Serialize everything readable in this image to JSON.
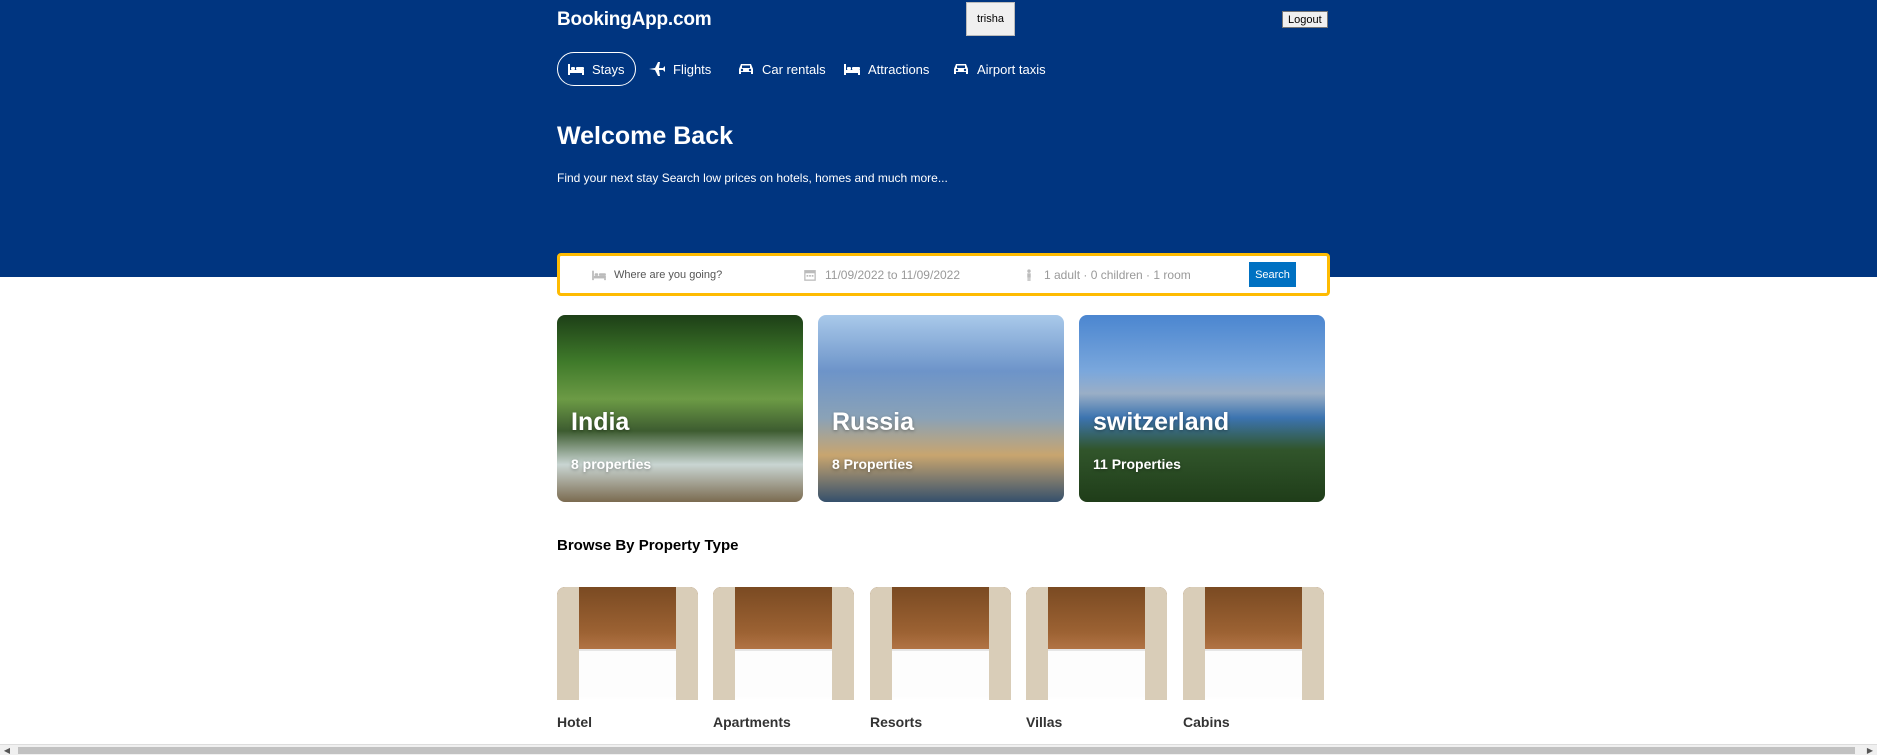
{
  "navbar": {
    "logo": "BookingApp.com",
    "user_label": "trisha",
    "logout_label": "Logout"
  },
  "tabs": [
    {
      "label": "Stays",
      "icon": "bed-icon",
      "active": true
    },
    {
      "label": "Flights",
      "icon": "plane-icon",
      "active": false
    },
    {
      "label": "Car rentals",
      "icon": "car-icon",
      "active": false
    },
    {
      "label": "Attractions",
      "icon": "bed-icon",
      "active": false
    },
    {
      "label": "Airport taxis",
      "icon": "taxi-icon",
      "active": false
    }
  ],
  "hero": {
    "title": "Welcome Back",
    "subtitle": "Find your next stay Search low prices on hotels, homes and much more..."
  },
  "search": {
    "destination_placeholder": "Where are you going?",
    "dates": "11/09/2022 to 11/09/2022",
    "guests": "1 adult · 0 children · 1 room",
    "button_label": "Search"
  },
  "featured": [
    {
      "city": "India",
      "properties": "8 properties"
    },
    {
      "city": "Russia",
      "properties": "8 Properties"
    },
    {
      "city": "switzerland",
      "properties": "11 Properties"
    }
  ],
  "property_types": {
    "title": "Browse By Property Type",
    "items": [
      {
        "name": "Hotel"
      },
      {
        "name": "Apartments"
      },
      {
        "name": "Resorts"
      },
      {
        "name": "Villas"
      },
      {
        "name": "Cabins"
      }
    ]
  },
  "colors": {
    "header_bg": "#003580",
    "search_border": "#febb02",
    "search_button": "#0071c2"
  }
}
